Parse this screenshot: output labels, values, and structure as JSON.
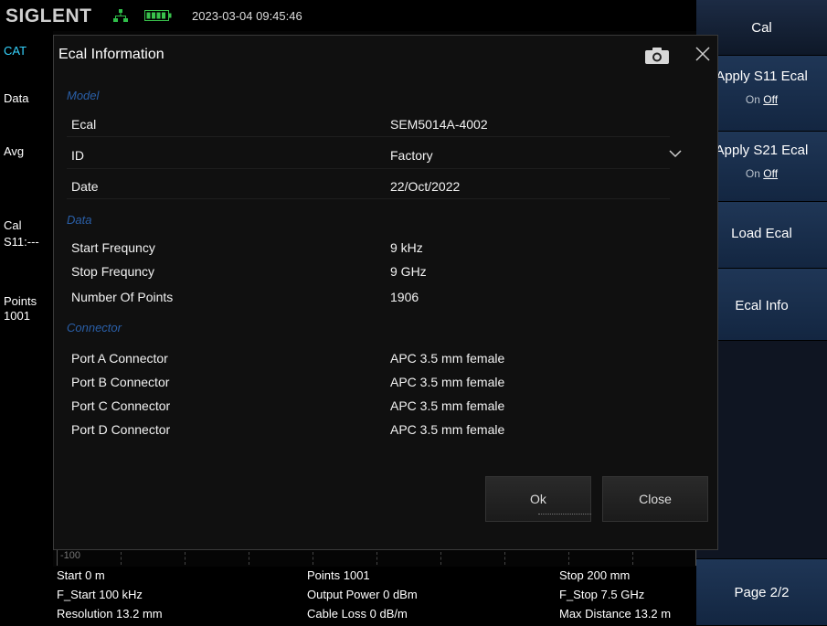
{
  "header": {
    "brand": "SIGLENT",
    "datetime": "2023-03-04 09:45:46"
  },
  "left_panel": {
    "cat": "CAT",
    "data": "Data",
    "avg": "Avg",
    "cal": "Cal",
    "s11": "S11:---",
    "points_label": "Points",
    "points_value": "1001"
  },
  "right_panel": {
    "cal_title": "Cal",
    "apply_s11": {
      "label": "Apply S11 Ecal",
      "on": "On",
      "off": "Off"
    },
    "apply_s21": {
      "label": "Apply S21 Ecal",
      "on": "On",
      "off": "Off"
    },
    "load_ecal": "Load Ecal",
    "ecal_info": "Ecal Info",
    "page": "Page 2/2"
  },
  "plot": {
    "ylabel": "-100"
  },
  "bottom_info": {
    "start": "Start  0 m",
    "points": "Points  1001",
    "stop": "Stop  200 mm",
    "f_start": "F_Start  100 kHz",
    "output_power": "Output Power  0 dBm",
    "f_stop": "F_Stop  7.5 GHz",
    "resolution": "Resolution  13.2 mm",
    "cable_loss": "Cable Loss  0 dB/m",
    "max_distance": "Max Distance  13.2 m"
  },
  "dialog": {
    "title": "Ecal Information",
    "sections": {
      "model": "Model",
      "data": "Data",
      "connector": "Connector"
    },
    "model_rows": [
      {
        "label": "Ecal",
        "value": "SEM5014A-4002"
      },
      {
        "label": "ID",
        "value": "Factory"
      },
      {
        "label": "Date",
        "value": "22/Oct/2022"
      }
    ],
    "data_rows": [
      {
        "label": "Start Frequncy",
        "value": "9 kHz"
      },
      {
        "label": "Stop Frequncy",
        "value": "9 GHz"
      },
      {
        "label": "Number Of Points",
        "value": "1906"
      }
    ],
    "connector_rows": [
      {
        "label": "Port A Connector",
        "value": "APC 3.5 mm female"
      },
      {
        "label": "Port B Connector",
        "value": "APC 3.5 mm female"
      },
      {
        "label": "Port C Connector",
        "value": "APC 3.5 mm female"
      },
      {
        "label": "Port D Connector",
        "value": "APC 3.5 mm female"
      }
    ],
    "ok_label": "Ok",
    "close_label": "Close"
  },
  "icons": {
    "network": "network-icon",
    "battery": "battery-icon",
    "camera": "camera-icon",
    "close": "close-icon",
    "dropdown": "chevron-down-icon"
  },
  "colors": {
    "accent_cyan": "#35d4ff",
    "section_blue": "#2a5fa8",
    "network_green": "#2fbf4a",
    "battery_green": "#39c24c"
  }
}
